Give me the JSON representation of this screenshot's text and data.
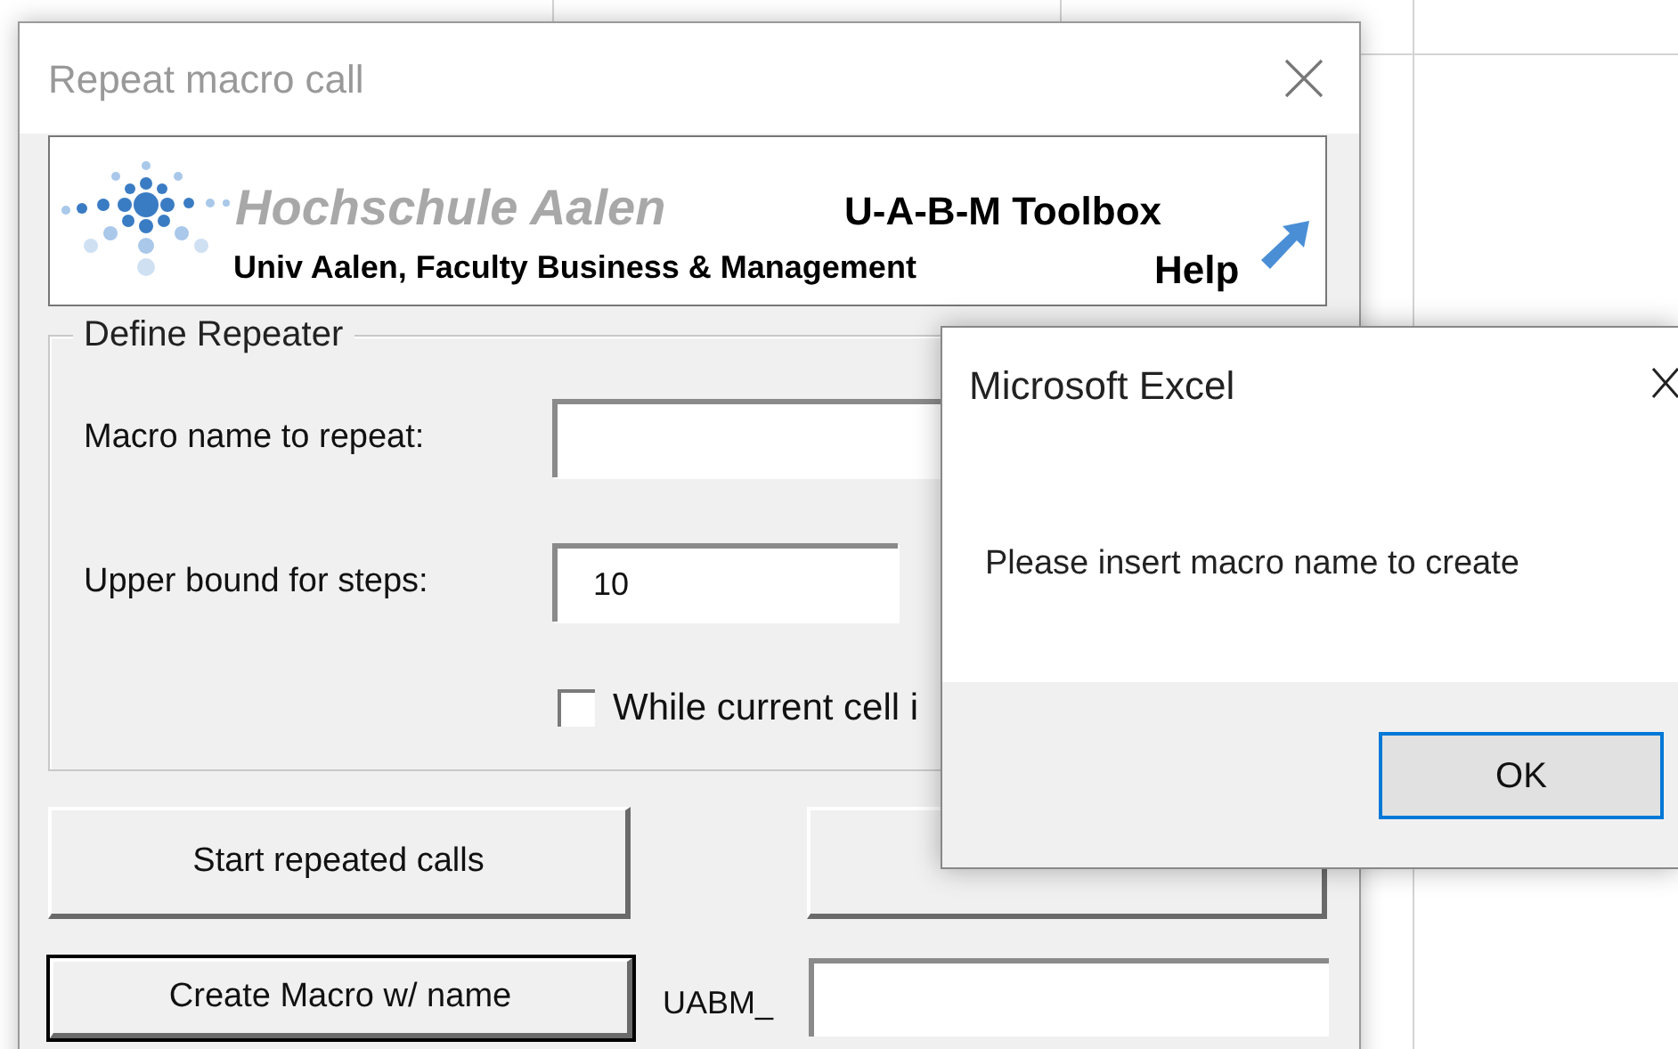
{
  "dialog": {
    "title": "Repeat macro call",
    "banner": {
      "school": "Hochschule Aalen",
      "faculty": "Univ Aalen, Faculty Business & Management",
      "toolbox": "U-A-B-M Toolbox",
      "help": "Help"
    },
    "group": {
      "title": "Define Repeater",
      "fields": [
        {
          "label": "Macro name to repeat:"
        },
        {
          "label": "Upper bound for steps:",
          "value": "10"
        }
      ],
      "checkbox": {
        "label": "While current cell i",
        "checked": false
      }
    },
    "buttons": [
      {
        "label": "Start repeated calls",
        "focused": false
      },
      {
        "label": "Create Macro w/ name",
        "focused": true
      }
    ],
    "prefix_label": "UABM_"
  },
  "message_box": {
    "title": "Microsoft Excel",
    "message": "Please insert macro name to create",
    "buttons": [
      {
        "label": "OK",
        "default": true
      }
    ]
  }
}
